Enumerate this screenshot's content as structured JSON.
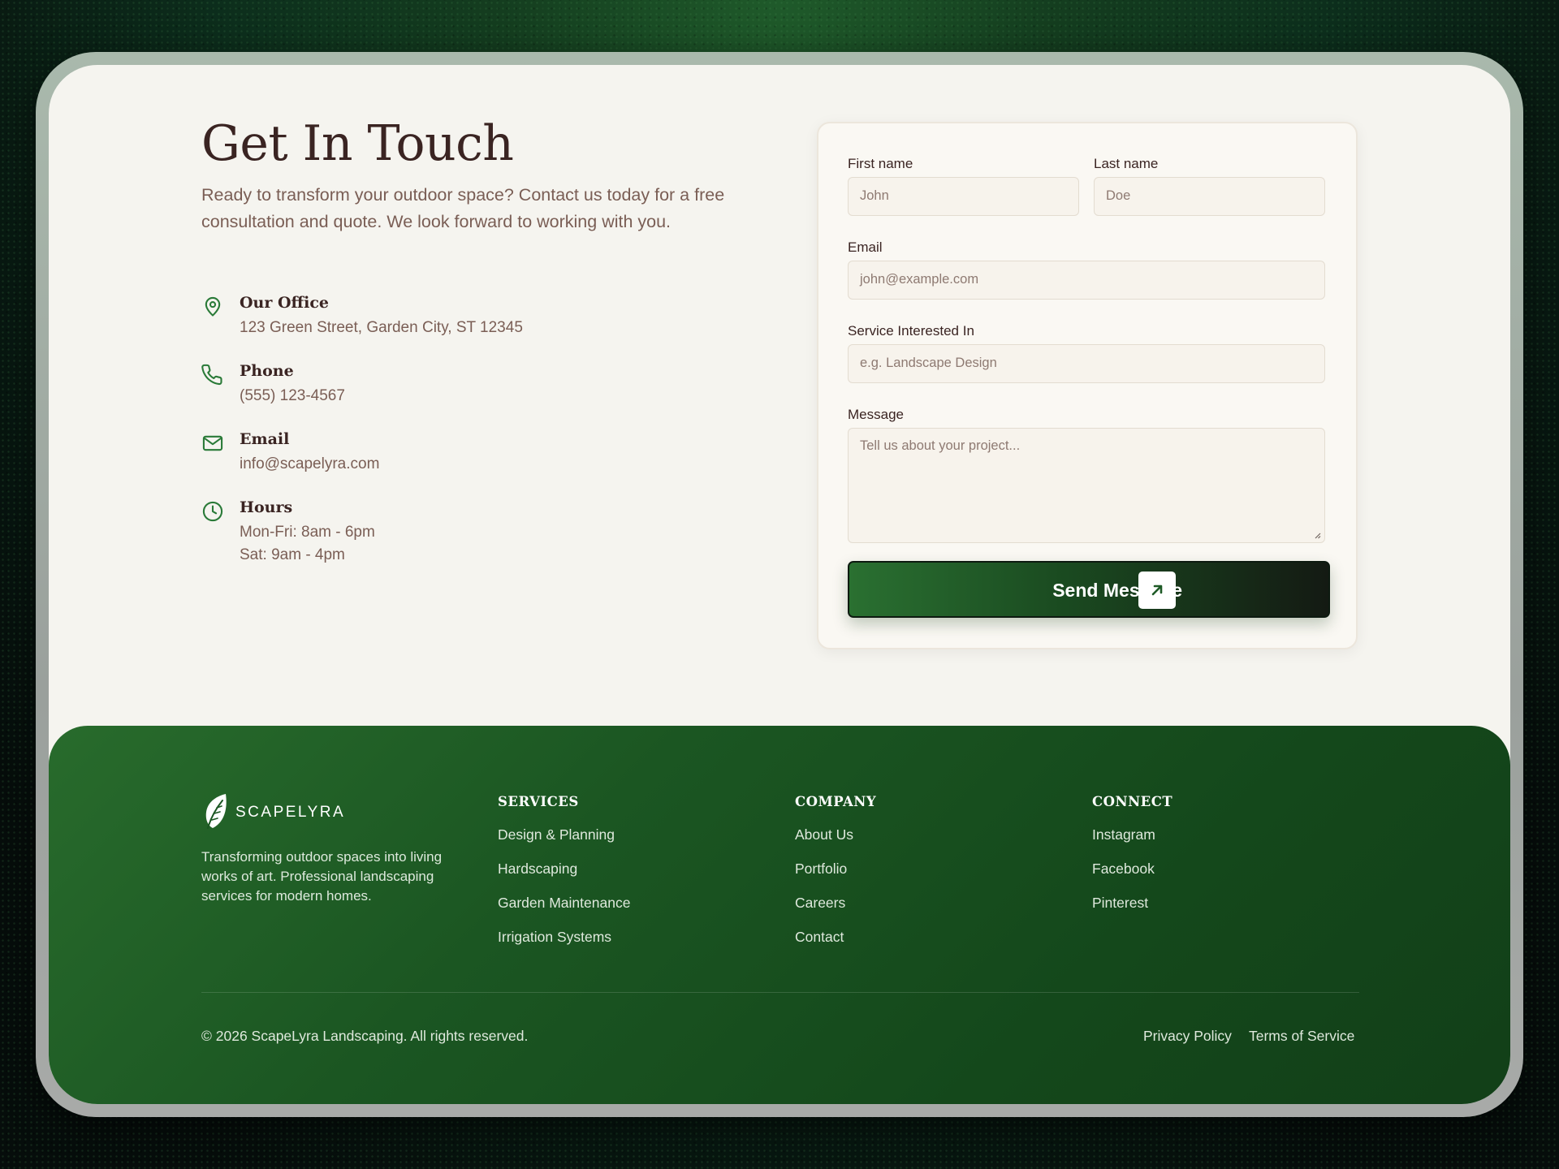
{
  "contact": {
    "title": "Get In Touch",
    "intro": "Ready to transform your outdoor space? Contact us today for a free consultation and quote. We look forward to working with you.",
    "items": [
      {
        "icon": "map-pin-icon",
        "title": "Our Office",
        "lines": [
          "123 Green Street, Garden City, ST 12345"
        ]
      },
      {
        "icon": "phone-icon",
        "title": "Phone",
        "lines": [
          "(555) 123-4567"
        ]
      },
      {
        "icon": "mail-icon",
        "title": "Email",
        "lines": [
          "info@scapelyra.com"
        ]
      },
      {
        "icon": "clock-icon",
        "title": "Hours",
        "lines": [
          "Mon-Fri: 8am - 6pm",
          "Sat: 9am - 4pm"
        ]
      }
    ]
  },
  "form": {
    "first_name_label": "First name",
    "first_name_placeholder": "John",
    "last_name_label": "Last name",
    "last_name_placeholder": "Doe",
    "email_label": "Email",
    "email_placeholder": "john@example.com",
    "service_label": "Service Interested In",
    "service_placeholder": "e.g. Landscape Design",
    "message_label": "Message",
    "message_placeholder": "Tell us about your project...",
    "submit_label": "Send Message",
    "submit_icon": "arrow-up-right-icon"
  },
  "footer": {
    "brand": "SCAPELYRA",
    "brand_icon": "leaf-logo-icon",
    "description": "Transforming outdoor spaces into living works of art. Professional landscaping services for modern homes.",
    "columns": [
      {
        "title": "SERVICES",
        "links": [
          "Design & Planning",
          "Hardscaping",
          "Garden Maintenance",
          "Irrigation Systems"
        ]
      },
      {
        "title": "COMPANY",
        "links": [
          "About Us",
          "Portfolio",
          "Careers",
          "Contact"
        ]
      },
      {
        "title": "CONNECT",
        "links": [
          "Instagram",
          "Facebook",
          "Pinterest"
        ]
      }
    ],
    "copyright": "© 2026 ScapeLyra Landscaping. All rights reserved.",
    "legal_links": [
      "Privacy Policy",
      "Terms of Service"
    ]
  },
  "colors": {
    "accent_green": "#2a7a38",
    "heading": "#3a2422",
    "body_text": "#7a5e55",
    "footer_bg": "#1b5622"
  }
}
